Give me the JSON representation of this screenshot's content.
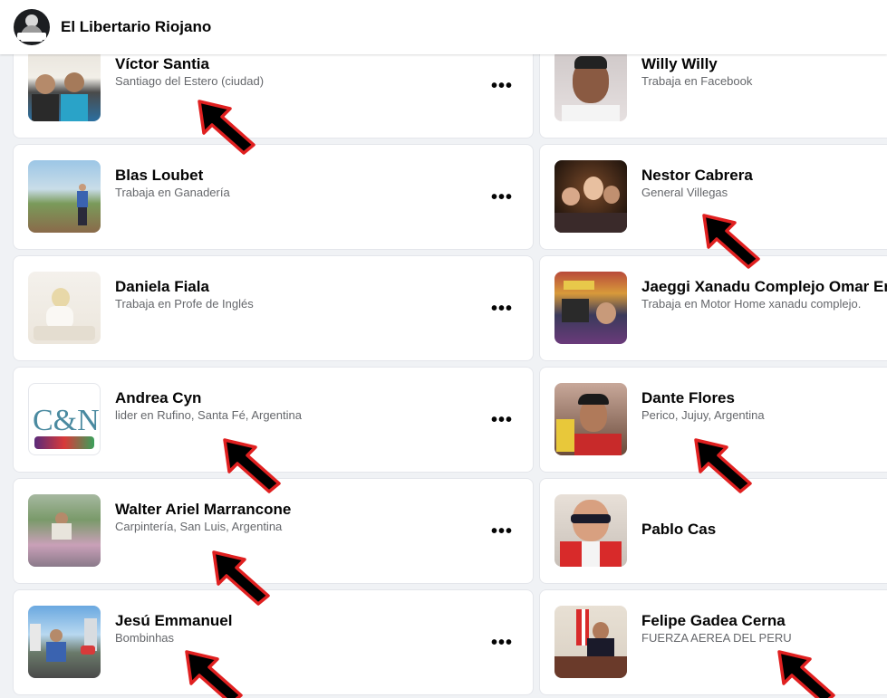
{
  "page": {
    "title": "El Libertario Riojano",
    "avatar_text": "EL LIBERTARIO RIOJANO"
  },
  "friends": [
    {
      "name": "Víctor Santia",
      "subtitle": "Santiago del Estero (ciudad)"
    },
    {
      "name": "Willy Willy",
      "subtitle": "Trabaja en Facebook"
    },
    {
      "name": "Blas Loubet",
      "subtitle": "Trabaja en Ganadería"
    },
    {
      "name": "Nestor Cabrera",
      "subtitle": "General Villegas"
    },
    {
      "name": "Daniela Fiala",
      "subtitle": "Trabaja en Profe de Inglés"
    },
    {
      "name": "Jaeggi Xanadu Complejo Omar Enze",
      "subtitle": "Trabaja en Motor Home xanadu complejo."
    },
    {
      "name": "Andrea Cyn",
      "subtitle": "lider en Rufino, Santa Fé, Argentina"
    },
    {
      "name": "Dante Flores",
      "subtitle": "Perico, Jujuy, Argentina"
    },
    {
      "name": "Walter Ariel Marrancone",
      "subtitle": "Carpintería, San Luis, Argentina"
    },
    {
      "name": "Pablo Cas",
      "subtitle": ""
    },
    {
      "name": "Jesú Emmanuel",
      "subtitle": "Bombinhas"
    },
    {
      "name": "Felipe Gadea Cerna",
      "subtitle": "FUERZA AEREA DEL PERU"
    }
  ],
  "icons": {
    "more": "more-options-icon",
    "arrow": "annotation-arrow"
  },
  "more_label": "•••",
  "colors": {
    "arrow_fill": "#000000",
    "arrow_stroke": "#e02020",
    "subtitle": "#65676b"
  }
}
